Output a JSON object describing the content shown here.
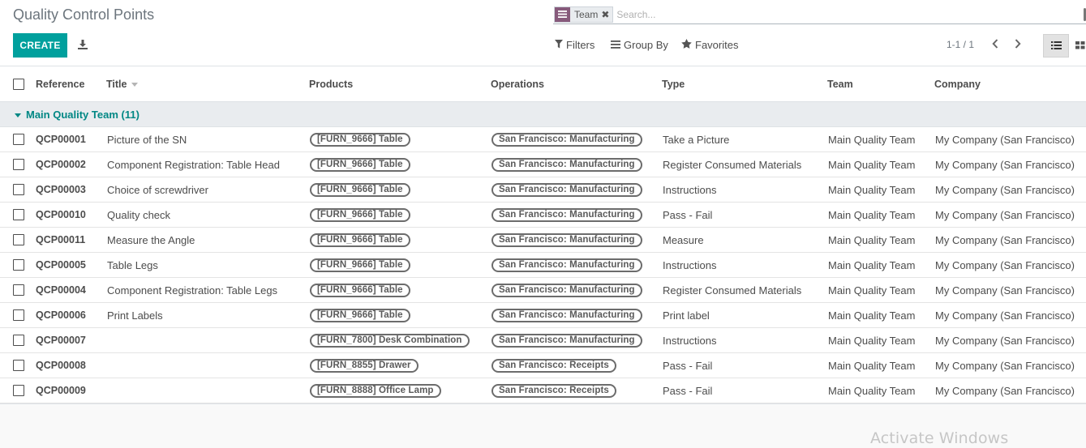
{
  "page": {
    "title": "Quality Control Points",
    "create_label": "CREATE",
    "download_icon": "download-icon"
  },
  "search": {
    "facet_label": "Team",
    "facet_icon": "list-icon",
    "placeholder": "Search..."
  },
  "menus": {
    "filters": "Filters",
    "group_by": "Group By",
    "favorites": "Favorites"
  },
  "pager": {
    "value": "1-1 / 1"
  },
  "columns": {
    "reference": "Reference",
    "title": "Title",
    "products": "Products",
    "operations": "Operations",
    "type": "Type",
    "team": "Team",
    "company": "Company"
  },
  "group": {
    "label": "Main Quality Team (11)"
  },
  "rows": [
    {
      "ref": "QCP00001",
      "title": "Picture of the SN",
      "product": "[FURN_9666] Table",
      "operation": "San Francisco: Manufacturing",
      "type": "Take a Picture",
      "team": "Main Quality Team",
      "company": "My Company (San Francisco)"
    },
    {
      "ref": "QCP00002",
      "title": "Component Registration: Table Head",
      "product": "[FURN_9666] Table",
      "operation": "San Francisco: Manufacturing",
      "type": "Register Consumed Materials",
      "team": "Main Quality Team",
      "company": "My Company (San Francisco)"
    },
    {
      "ref": "QCP00003",
      "title": "Choice of screwdriver",
      "product": "[FURN_9666] Table",
      "operation": "San Francisco: Manufacturing",
      "type": "Instructions",
      "team": "Main Quality Team",
      "company": "My Company (San Francisco)"
    },
    {
      "ref": "QCP00010",
      "title": "Quality check",
      "product": "[FURN_9666] Table",
      "operation": "San Francisco: Manufacturing",
      "type": "Pass - Fail",
      "team": "Main Quality Team",
      "company": "My Company (San Francisco)"
    },
    {
      "ref": "QCP00011",
      "title": "Measure the Angle",
      "product": "[FURN_9666] Table",
      "operation": "San Francisco: Manufacturing",
      "type": "Measure",
      "team": "Main Quality Team",
      "company": "My Company (San Francisco)"
    },
    {
      "ref": "QCP00005",
      "title": "Table Legs",
      "product": "[FURN_9666] Table",
      "operation": "San Francisco: Manufacturing",
      "type": "Instructions",
      "team": "Main Quality Team",
      "company": "My Company (San Francisco)"
    },
    {
      "ref": "QCP00004",
      "title": "Component Registration: Table Legs",
      "product": "[FURN_9666] Table",
      "operation": "San Francisco: Manufacturing",
      "type": "Register Consumed Materials",
      "team": "Main Quality Team",
      "company": "My Company (San Francisco)"
    },
    {
      "ref": "QCP00006",
      "title": "Print Labels",
      "product": "[FURN_9666] Table",
      "operation": "San Francisco: Manufacturing",
      "type": "Print label",
      "team": "Main Quality Team",
      "company": "My Company (San Francisco)"
    },
    {
      "ref": "QCP00007",
      "title": "",
      "product": "[FURN_7800] Desk Combination",
      "operation": "San Francisco: Manufacturing",
      "type": "Instructions",
      "team": "Main Quality Team",
      "company": "My Company (San Francisco)"
    },
    {
      "ref": "QCP00008",
      "title": "",
      "product": "[FURN_8855] Drawer",
      "operation": "San Francisco: Receipts",
      "type": "Pass - Fail",
      "team": "Main Quality Team",
      "company": "My Company (San Francisco)"
    },
    {
      "ref": "QCP00009",
      "title": "",
      "product": "[FURN_8888] Office Lamp",
      "operation": "San Francisco: Receipts",
      "type": "Pass - Fail",
      "team": "Main Quality Team",
      "company": "My Company (San Francisco)"
    }
  ],
  "watermark": "Activate Windows",
  "colors": {
    "primary": "#00a09d",
    "group_text": "#008784",
    "facet_accent": "#875a7b"
  }
}
